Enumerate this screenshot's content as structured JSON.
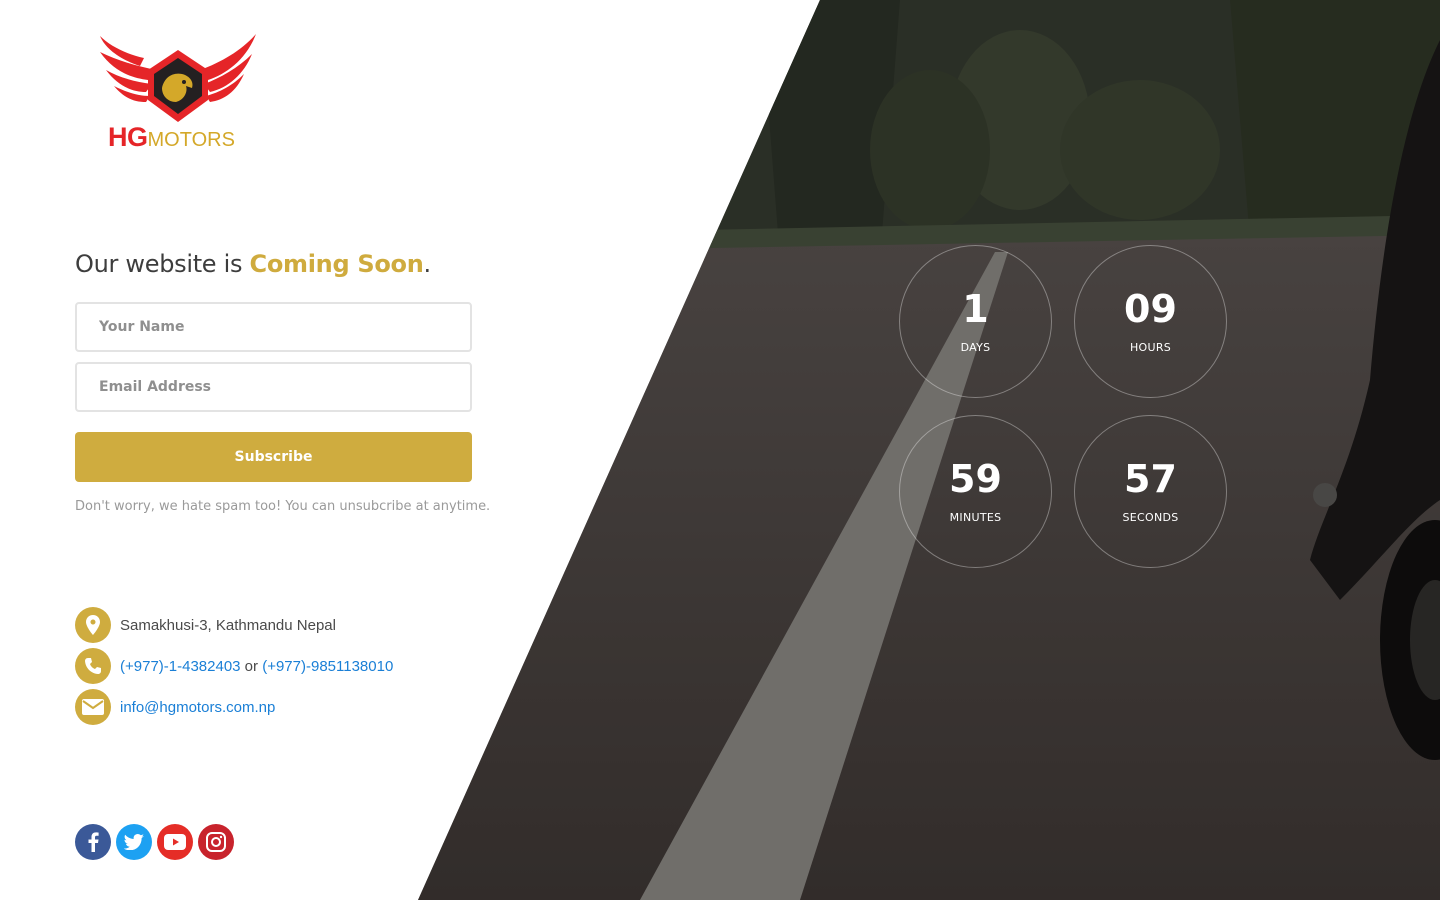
{
  "brand": {
    "logo_hg": "HG",
    "logo_motors": "MOTORS"
  },
  "headline": {
    "prefix": "Our website is ",
    "accent": "Coming Soon",
    "suffix": "."
  },
  "form": {
    "name_placeholder": "Your Name",
    "email_placeholder": "Email Address",
    "subscribe_label": "Subscribe",
    "note": "Don't worry, we hate spam too! You can unsubcribe at anytime."
  },
  "contact": {
    "address": "Samakhusi-3, Kathmandu Nepal",
    "phone_1": "(+977)-1-4382403",
    "phone_sep": " or ",
    "phone_2": "(+977)-9851138010",
    "email": "info@hgmotors.com.np"
  },
  "social": [
    {
      "icon": "facebook-icon",
      "color": "#3b5998"
    },
    {
      "icon": "twitter-icon",
      "color": "#1da1f2"
    },
    {
      "icon": "youtube-icon",
      "color": "#e52d27"
    },
    {
      "icon": "instagram-icon",
      "color": "#c8232c"
    }
  ],
  "countdown": {
    "days": {
      "value": "1",
      "label": "DAYS"
    },
    "hours": {
      "value": "09",
      "label": "HOURS"
    },
    "minutes": {
      "value": "59",
      "label": "MINUTES"
    },
    "seconds": {
      "value": "57",
      "label": "SECONDS"
    }
  },
  "colors": {
    "accent": "#cfac3f",
    "link": "#1a7fd6",
    "brand_red": "#e52528"
  }
}
